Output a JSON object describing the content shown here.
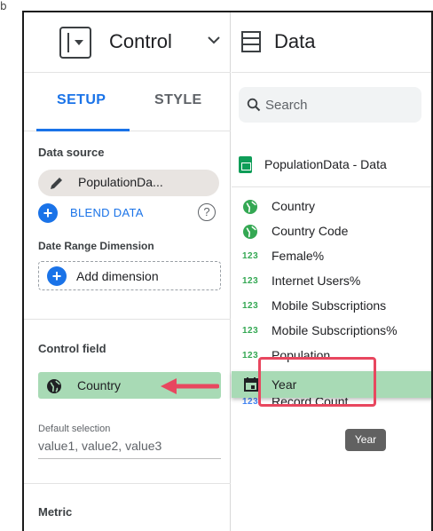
{
  "corner_mark": "b",
  "control_panel": {
    "title": "Control",
    "tabs": [
      {
        "label": "SETUP",
        "active": true
      },
      {
        "label": "STYLE",
        "active": false
      }
    ],
    "data_source": {
      "label": "Data source",
      "value": "PopulationDa...",
      "blend_label": "BLEND DATA",
      "help_icon": "?"
    },
    "date_range": {
      "label": "Date Range Dimension",
      "add_label": "Add dimension"
    },
    "control_field": {
      "label": "Control field",
      "value": "Country"
    },
    "default_selection": {
      "label": "Default selection",
      "value": "value1, value2, value3"
    },
    "metric": {
      "label": "Metric"
    }
  },
  "data_panel": {
    "title": "Data",
    "search_placeholder": "Search",
    "data_source": "PopulationData - Data",
    "fields": [
      {
        "icon": "globe-icon",
        "label": "Country"
      },
      {
        "icon": "globe-icon",
        "label": "Country Code"
      },
      {
        "icon": "123",
        "label": "Female%"
      },
      {
        "icon": "123",
        "label": "Internet Users%"
      },
      {
        "icon": "123",
        "label": "Mobile Subscriptions"
      },
      {
        "icon": "123",
        "label": "Mobile Subscriptions%"
      },
      {
        "icon": "123",
        "label": "Population"
      },
      {
        "icon": "calendar-icon",
        "label": "Year",
        "dragging": true
      },
      {
        "icon": "123",
        "label": "Record Count"
      }
    ],
    "tooltip": "Year"
  },
  "colors": {
    "accent_blue": "#1a73e8",
    "chip_green": "#a8dab5",
    "highlight_red": "#e8475f",
    "arrow_red": "#e8475f",
    "numeric_green": "#34a853"
  }
}
